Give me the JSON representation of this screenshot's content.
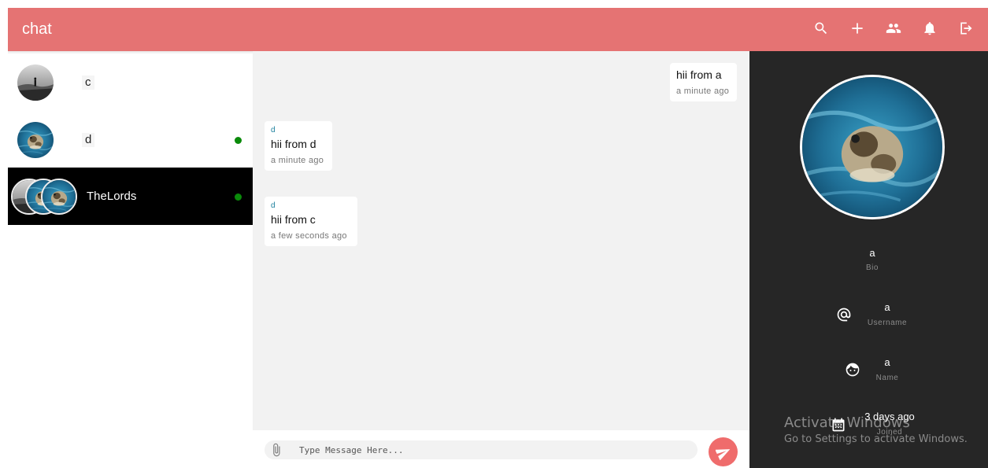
{
  "app": {
    "title": "chat",
    "accent_color": "#e57373",
    "actions": [
      "search-icon",
      "add-icon",
      "group-icon",
      "bell-icon",
      "logout-icon"
    ]
  },
  "sidebar": {
    "chats": [
      {
        "name": "c",
        "avatar": "man-on-cliff-image",
        "online": false,
        "active": false
      },
      {
        "name": "d",
        "avatar": "sea-turtle-image",
        "online": true,
        "active": false
      },
      {
        "name": "TheLords",
        "avatar": "group-avatars-image",
        "online": true,
        "active": true
      }
    ],
    "online_color": "#0a8a0a"
  },
  "messages": [
    {
      "sender": "",
      "text": "hii from a",
      "time": "a minute ago",
      "own": true
    },
    {
      "sender": "d",
      "text": "hii from d",
      "time": "a minute ago",
      "own": false
    },
    {
      "sender": "d",
      "text": "hii from c",
      "time": "a few seconds ago",
      "own": false
    }
  ],
  "composer": {
    "placeholder": "Type Message Here...",
    "value": "",
    "send_color": "#ef6c6c"
  },
  "profile": {
    "avatar": "sea-turtle-image",
    "bio": {
      "value": "a",
      "label": "Bio"
    },
    "username": {
      "value": "a",
      "label": "Username",
      "icon": "at-sign-icon"
    },
    "name": {
      "value": "a",
      "label": "Name",
      "icon": "face-icon"
    },
    "joined": {
      "value": "3 days ago",
      "label": "Joined",
      "icon": "calendar-icon"
    }
  },
  "watermark": {
    "line1": "Activate Windows",
    "line2": "Go to Settings to activate Windows."
  }
}
